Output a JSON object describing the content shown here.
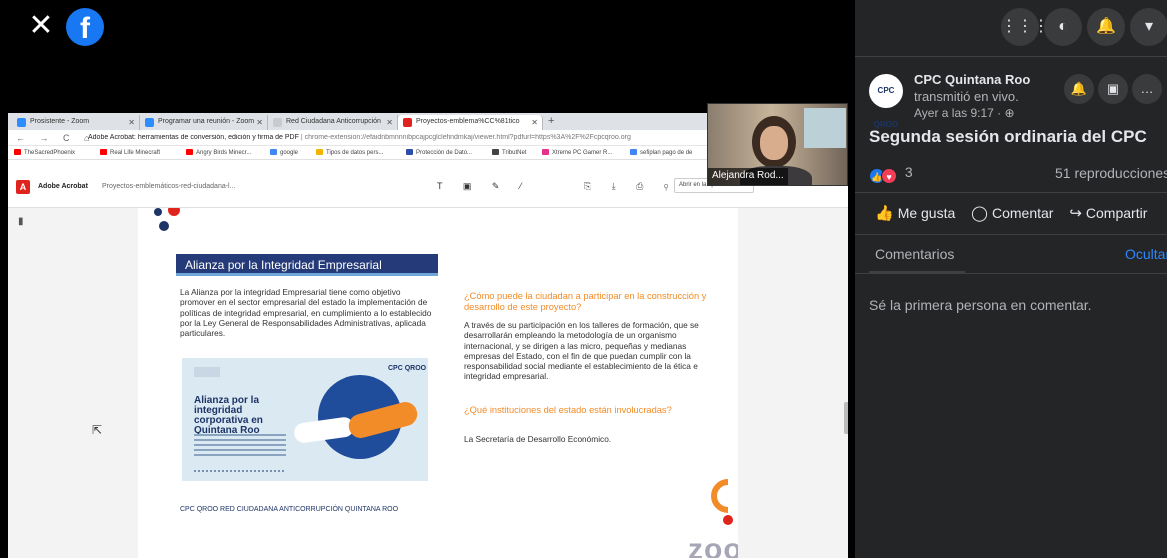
{
  "overlay": {
    "close_glyph": "✕",
    "fb_glyph": "f"
  },
  "browser": {
    "tabs": [
      {
        "label": "Prosistente - Zoom",
        "icon_color": "#2d8cff"
      },
      {
        "label": "Programar una reunión - Zoom",
        "icon_color": "#2d8cff"
      },
      {
        "label": "Red Ciudadana Anticorrupción",
        "icon_color": "#e8eaed"
      },
      {
        "label": "Proyectos-emblema%CC%81tico",
        "icon_color": "#e0241d"
      }
    ],
    "tab_close": "✕",
    "new_tab": "+",
    "nav": "← → C ⌂",
    "url_prefix": "Adobe Acrobat: herramientas de conversión, edición y firma de PDF",
    "url_rest": "| chrome-extension://efaidnbmnnnibpcajpcglclefindmkaj/viewer.html?pdfurl=https%3A%2F%2Fcpcqroo.org",
    "bookmarks": [
      {
        "label": "TheSacredPhoenix",
        "color": "#ff0000"
      },
      {
        "label": "Real Life Minecraft",
        "color": "#ff0000"
      },
      {
        "label": "Angry Birds Minecr...",
        "color": "#ff0000"
      },
      {
        "label": "google",
        "color": "#4285f4"
      },
      {
        "label": "Tipos de datos pers...",
        "color": "#f5b400"
      },
      {
        "label": "Protección de Dato...",
        "color": "#2b4fa8"
      },
      {
        "label": "TributNet",
        "color": "#444444"
      },
      {
        "label": "Xtreme PC Gamer R...",
        "color": "#e72f8c"
      },
      {
        "label": "sefiplan pago de de",
        "color": "#4285f4"
      }
    ],
    "acrobat_name": "Adobe Acrobat",
    "acrobat_doc": "Proyectos-emblemáticos-red-ciudadana-l...",
    "acrobat_logo": "A",
    "tool_glyphs": "T ▣ ✎ ⁄",
    "right_glyphs": "⎘ ⤓ ⎙ ⚲",
    "open_in": "Abrir en la aplicaci...",
    "rail_glyph": "▮",
    "cursor_glyph": "⇱"
  },
  "document": {
    "banner": "Alianza por la Integridad Empresarial",
    "para1": "La Alianza por la integridad Empresarial tiene como objetivo promover en el sector empresarial del estado la implementación de políticas de integridad empresarial, en cumplimiento a lo establecido por la Ley General de Responsabilidades Administrativas, aplicada particulares.",
    "question1": "¿Cómo puede la ciudadan a participar en la construcción y desarrollo de este proyecto?",
    "para2": "A través de su participación en los talleres de formación, que se desarrollarán empleando la metodología de un organismo internacional, y se dirigen a las micro, pequeñas y medianas empresas del Estado, con el fin de que puedan cumplir con la responsabilidad social mediante el establecimiento de la ética e integridad empresarial.",
    "question2": "¿Qué instituciones del estado están involucradas?",
    "para3": "La Secretaría de Desarrollo Económico.",
    "card_title": "Alianza por la integridad corporativa en Quintana Roo",
    "card_logo": "CPC QROO",
    "footer_logos": "CPC QROO    RED CIUDADANA ANTICORRUPCIÓN    QUINTANA ROO",
    "zoom_watermark": "zoom"
  },
  "speaker": {
    "name": "Alejandra Rod..."
  },
  "sidebar": {
    "top_buttons": [
      {
        "icon": "grid-icon",
        "glyph": "⋮⋮⋮"
      },
      {
        "icon": "messenger-icon",
        "glyph": "◐"
      },
      {
        "icon": "bell-icon",
        "glyph": "🔔"
      },
      {
        "icon": "chevron-down-icon",
        "glyph": "▾"
      }
    ],
    "page_avatar": "CPC QROO",
    "page_name": "CPC Quintana Roo",
    "page_sub": "transmitió en vivo.",
    "page_time": "Ayer a las 9:17 · ⊕",
    "small_buttons": [
      {
        "icon": "bell-icon",
        "glyph": "🔔"
      },
      {
        "icon": "bookmark-icon",
        "glyph": "▣"
      },
      {
        "icon": "more-icon",
        "glyph": "…"
      }
    ],
    "post_title": "Segunda sesión ordinaria del CPC",
    "reaction_count": "3",
    "like_glyph": "👍",
    "love_glyph": "♥",
    "views": "51 reproducciones",
    "actions": [
      {
        "icon": "like-icon",
        "glyph": "👍",
        "label": "Me gusta"
      },
      {
        "icon": "comment-icon",
        "glyph": "◯",
        "label": "Comentar"
      },
      {
        "icon": "share-icon",
        "glyph": "↪",
        "label": "Compartir"
      }
    ],
    "comments_tab": "Comentarios",
    "hide_link": "Ocultar",
    "first_comment": "Sé la primera persona en comentar.",
    "colors": {
      "background": "#242526",
      "link": "#2d88ff",
      "like": "#1877f2",
      "love": "#f33e58"
    }
  }
}
